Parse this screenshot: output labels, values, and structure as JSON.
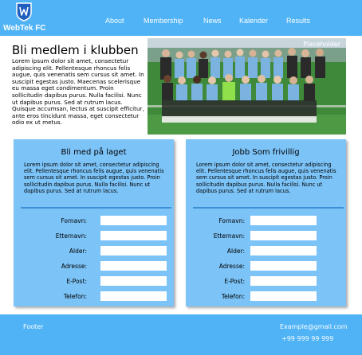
{
  "header": {
    "logo_text": "WebTek FC",
    "nav": [
      "About",
      "Membership",
      "News",
      "Kalender",
      "Results"
    ]
  },
  "intro": {
    "title": "Bli medlem i klubben",
    "text": "Lorem ipsum dolor sit amet, consectetur adipiscing elit. Pellentesque rhoncus felis augue, quis venenatis sem cursus sit amet. In suscipit egestas justo. Maecenas scelerisque eu massa eget condimentum. Proin sollicitudin dapibus purus. Nulla facilisi. Nunc ut dapibus purus. Sed at rutrum lacus. Quisque accumsan, lectus at suscipit efficitur, ante eros tincidunt massa, eget consectetur odio ex ut metus.",
    "image_label": "Placeholder"
  },
  "cards": [
    {
      "title": "Bli med på laget",
      "text": "Lorem ipsum dolor sit amet, consectetur adipiscing elit. Pellentesque rhoncus felis augue, quis venenatis sem cursus sit amet. In suscipit egestas justo. Proin sollicitudin dapibus purus. Nulla facilisi. Nunc ut dapibus purus. Sed at rutrum lacus.",
      "fields": [
        "Fornavn:",
        "Etternavn:",
        "Alder:",
        "Adresse:",
        "E-Post:",
        "Telefon:"
      ]
    },
    {
      "title": "Jobb Som frivillig",
      "text": "Lorem ipsum dolor sit amet, consectetur adipiscing elit. Pellentesque rhoncus felis augue, quis venenatis sem cursus sit amet. In suscipit egestas justo. Proin sollicitudin dapibus purus. Nulla facilisi. Nunc ut dapibus purus. Sed at rutrum lacus.",
      "fields": [
        "Fornavn:",
        "Etternavn:",
        "Alder:",
        "Adresse:",
        "E-Post:",
        "Telefon:"
      ]
    }
  ],
  "footer": {
    "label": "Footer",
    "email": "Example@gmail.com",
    "phone": "+99 999 99 999"
  },
  "colors": {
    "header_bg": "#4fb3f6",
    "card_bg": "#7cc3f7",
    "divider": "#3b8fd4"
  }
}
